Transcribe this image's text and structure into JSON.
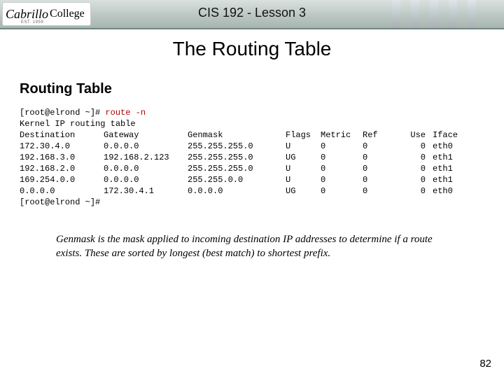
{
  "header": {
    "course_title": "CIS 192 - Lesson 3",
    "logo_script": "Cabrillo",
    "logo_word2": "College",
    "logo_est": "EST. 1959"
  },
  "titles": {
    "main": "The Routing Table",
    "section": "Routing Table"
  },
  "terminal": {
    "prompt1_prefix": "[root@elrond ~]# ",
    "command": "route -n",
    "kernel_line": "Kernel IP routing table",
    "headers": {
      "destination": "Destination",
      "gateway": "Gateway",
      "genmask": "Genmask",
      "flags": "Flags",
      "metric": "Metric",
      "ref": "Ref",
      "use": "Use",
      "iface": "Iface"
    },
    "rows": [
      {
        "destination": "172.30.4.0",
        "gateway": "0.0.0.0",
        "genmask": "255.255.255.0",
        "flags": "U",
        "metric": "0",
        "ref": "0",
        "use": "0",
        "iface": "eth0"
      },
      {
        "destination": "192.168.3.0",
        "gateway": "192.168.2.123",
        "genmask": "255.255.255.0",
        "flags": "UG",
        "metric": "0",
        "ref": "0",
        "use": "0",
        "iface": "eth1"
      },
      {
        "destination": "192.168.2.0",
        "gateway": "0.0.0.0",
        "genmask": "255.255.255.0",
        "flags": "U",
        "metric": "0",
        "ref": "0",
        "use": "0",
        "iface": "eth1"
      },
      {
        "destination": "169.254.0.0",
        "gateway": "0.0.0.0",
        "genmask": "255.255.0.0",
        "flags": "U",
        "metric": "0",
        "ref": "0",
        "use": "0",
        "iface": "eth1"
      },
      {
        "destination": "0.0.0.0",
        "gateway": "172.30.4.1",
        "genmask": "0.0.0.0",
        "flags": "UG",
        "metric": "0",
        "ref": "0",
        "use": "0",
        "iface": "eth0"
      }
    ],
    "prompt2": "[root@elrond ~]#"
  },
  "explanation": "Genmask is the mask applied to incoming destination IP addresses to determine if a route exists.  These are sorted by longest (best match) to shortest prefix.",
  "page_number": "82"
}
